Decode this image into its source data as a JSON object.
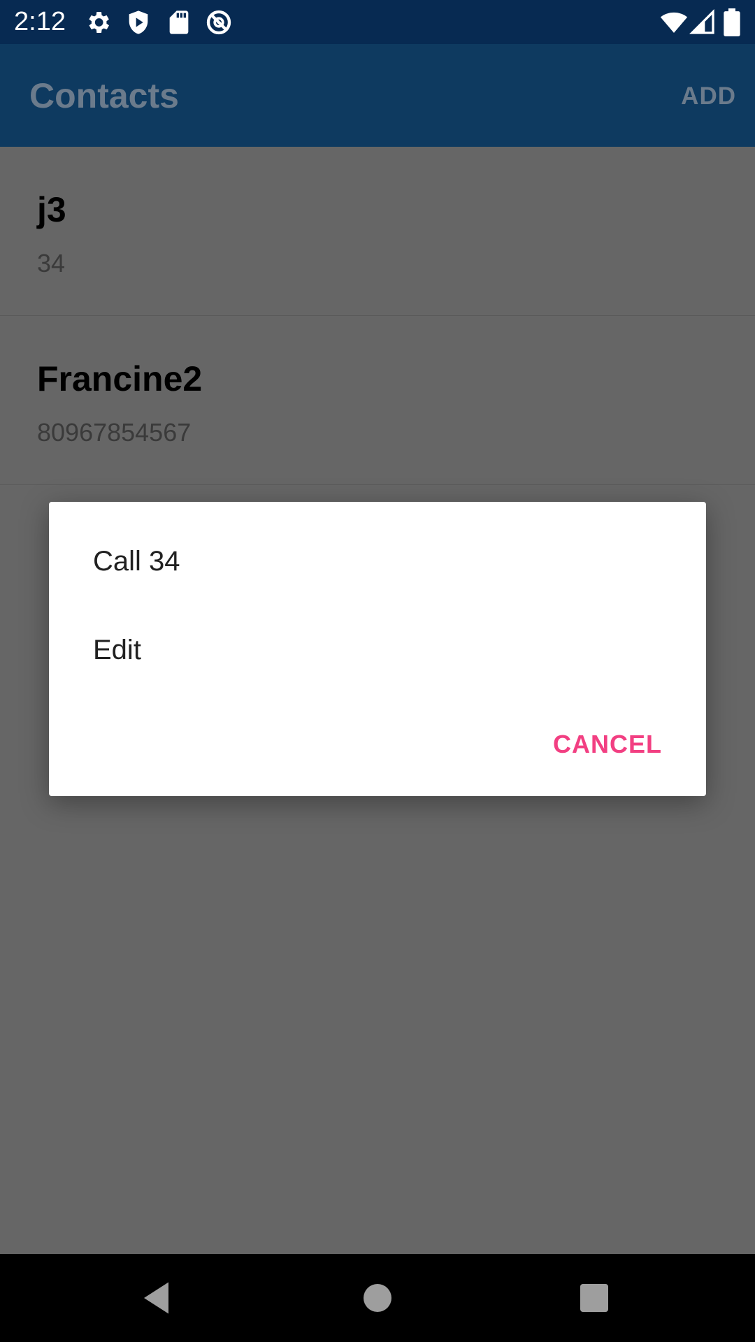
{
  "status_bar": {
    "time": "2:12",
    "left_icons": [
      "settings-icon",
      "shield-play-icon",
      "sd-card-icon",
      "no-sync-icon"
    ],
    "right_icons": [
      "wifi-icon",
      "cell-signal-icon",
      "battery-icon"
    ]
  },
  "app_bar": {
    "title": "Contacts",
    "add_label": "ADD"
  },
  "contacts": [
    {
      "name": "j3",
      "number": "34"
    },
    {
      "name": "Francine2",
      "number": "80967854567"
    }
  ],
  "dialog": {
    "items": [
      "Call 34",
      "Edit"
    ],
    "cancel_label": "CANCEL",
    "accent_color": "#f23f82"
  },
  "nav_bar": {
    "buttons": [
      "back-icon",
      "home-icon",
      "recents-icon"
    ]
  },
  "colors": {
    "status_bar": "#072a52",
    "app_bar": "#0e3a60",
    "scrim_background": "#666666"
  }
}
